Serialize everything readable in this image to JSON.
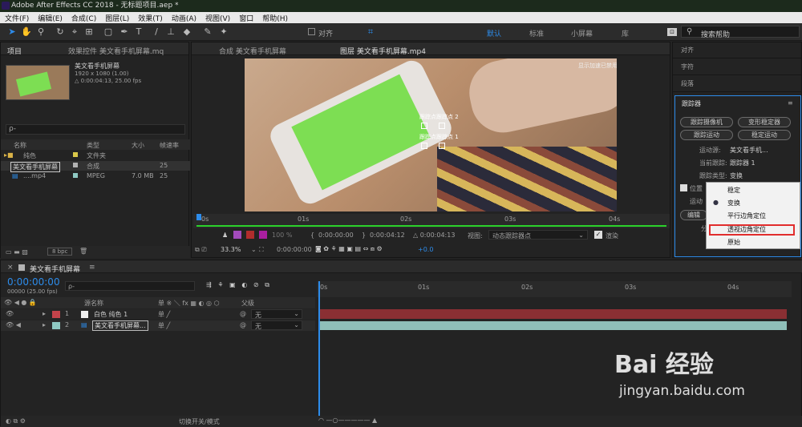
{
  "window": {
    "title": "Adobe After Effects CC 2018 - 无标题项目.aep *"
  },
  "menu": [
    "文件(F)",
    "编辑(E)",
    "合成(C)",
    "图层(L)",
    "效果(T)",
    "动画(A)",
    "视图(V)",
    "窗口",
    "帮助(H)"
  ],
  "toolbar": {
    "align_label": "对齐",
    "workspaces": [
      "默认",
      "标准",
      "小屏幕",
      "库"
    ],
    "search_placeholder": "搜索帮助"
  },
  "project": {
    "tab": "项目",
    "effects_tab": "效果控件 美文看手机屏幕.mq",
    "selected_name": "美文看手机屏幕",
    "selected_info1": "1920 x 1080 (1.00)",
    "selected_info2": "△ 0:00:04:13, 25.00 fps",
    "columns": [
      "名称",
      "类型",
      "大小",
      "帧速率"
    ],
    "items": [
      {
        "name": "纯色",
        "type": "文件夹",
        "size": "",
        "fps": ""
      },
      {
        "name": "美文看手机屏幕",
        "type": "合成",
        "size": "",
        "fps": "25"
      },
      {
        "name": "....mp4",
        "type": "MPEG",
        "size": "7.0 MB",
        "fps": "25"
      }
    ],
    "bpc": "8 bpc"
  },
  "viewer": {
    "comp_tab": "合成 美文看手机屏幕",
    "layer_tab": "图层 美文看手机屏幕.mp4",
    "accel_note": "显示加速已禁用",
    "track_point2": "跟踪点跟踪点 2",
    "track_point1": "跟踪点跟踪点 1",
    "ruler": [
      "0s",
      "01s",
      "02s",
      "03s",
      "04s"
    ],
    "time_start": "0:00:00:00",
    "time_end": "0:00:04:12",
    "duration": "△ 0:00:04:13",
    "view_label": "视图:",
    "view_value": "动态跟踪器点",
    "render_label": "渲染",
    "zoom": "33.3%",
    "current_time": "0:00:00:00",
    "exposure": "+0.0",
    "percent": "100 %"
  },
  "right": {
    "tabs": [
      "对齐",
      "字符",
      "段落"
    ],
    "tracker_title": "跟踪器",
    "buttons": [
      "跟踪摄像机",
      "变形稳定器",
      "跟踪运动",
      "稳定运动"
    ],
    "source_label": "运动源:",
    "source_value": "美文看手机...",
    "current_label": "当前跟踪:",
    "current_value": "跟踪器 1",
    "type_label": "跟踪类型:",
    "type_value": "变换",
    "position_label": "位置",
    "motion_label": "运动",
    "edit_label": "编辑",
    "analyze_label": "分"
  },
  "dropdown": {
    "items": [
      "稳定",
      "变换",
      "平行边角定位",
      "透视边角定位",
      "原始"
    ],
    "checked_index": 1,
    "highlight_index": 3
  },
  "timeline": {
    "tab": "美文看手机屏幕",
    "timecode": "0:00:00:00",
    "timecode_sub": "00000 (25.00 fps)",
    "search_placeholder": "ρ-",
    "col_name": "源名称",
    "col_parent": "父级",
    "ruler": [
      "0s",
      "01s",
      "02s",
      "03s",
      "04s"
    ],
    "layers": [
      {
        "num": "1",
        "name": "白色 纯色 1",
        "parent": "无",
        "color": "#c4434a"
      },
      {
        "num": "2",
        "name": "美文看手机屏幕...",
        "parent": "无",
        "color": "#8fc9c3"
      }
    ],
    "footer": "切换开关/模式"
  },
  "watermark": {
    "brand": "Bai 经验",
    "url": "jingyan.baidu.com"
  },
  "colors": {
    "accent": "#2d8ceb",
    "green_screen": "#7dde53",
    "red_track": "#8a2f33",
    "teal_track": "#8fbfb9",
    "highlight_box": "#e12d2d"
  }
}
